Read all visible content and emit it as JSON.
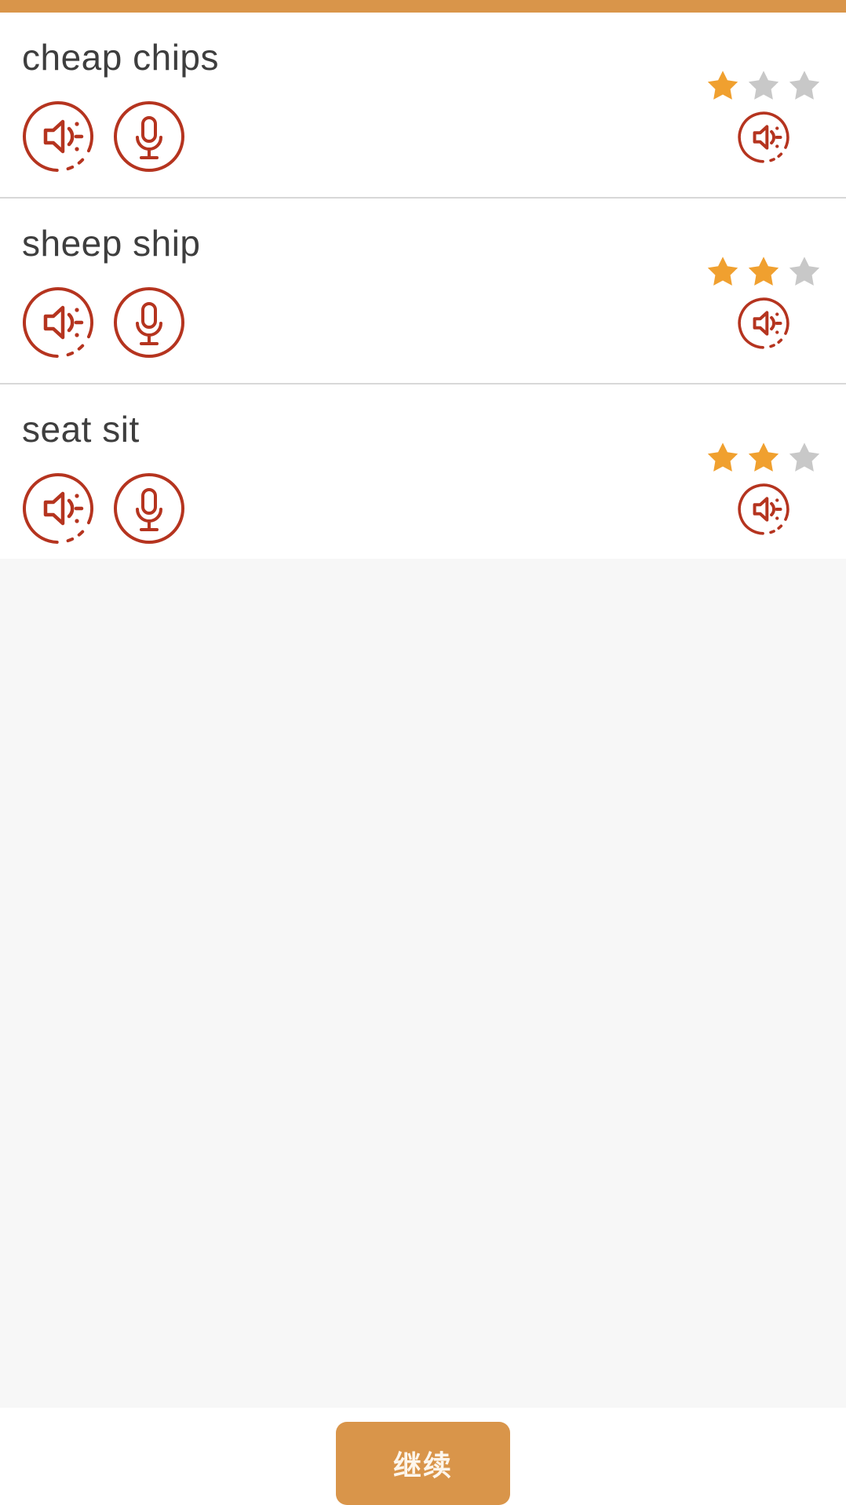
{
  "theme": {
    "accent_orange": "#d9954a",
    "star_filled": "#f0a02f",
    "star_empty": "#c8c8c8",
    "icon_red": "#b5341f",
    "text_dark": "#3e3e3e",
    "filler_gray": "#f7f7f7"
  },
  "top_bar": {
    "name": "progress-bar"
  },
  "rows": [
    {
      "word": "cheap chips",
      "listen_icon": "speaker-icon",
      "record_icon": "microphone-icon",
      "score_icon": "speaker-icon",
      "stars_filled": 1,
      "stars_total": 3
    },
    {
      "word": "sheep ship",
      "listen_icon": "speaker-icon",
      "record_icon": "microphone-icon",
      "score_icon": "speaker-icon",
      "stars_filled": 2,
      "stars_total": 3
    },
    {
      "word": "seat sit",
      "listen_icon": "speaker-icon",
      "record_icon": "microphone-icon",
      "score_icon": "speaker-icon",
      "stars_filled": 2,
      "stars_total": 3
    }
  ],
  "footer": {
    "continue_label": "继续"
  }
}
